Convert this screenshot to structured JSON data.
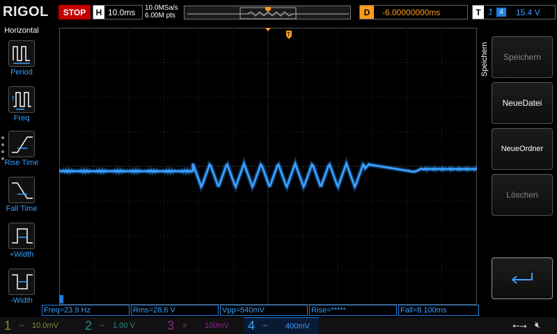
{
  "header": {
    "brand": "RIGOL",
    "run_state": "STOP",
    "horizontal": {
      "tag": "H",
      "timebase": "10.0ms"
    },
    "sample_rate": "10.0MSa/s",
    "memory_depth": "6.00M pts",
    "delay": {
      "tag": "D",
      "value": "-6.00000000ms"
    },
    "trigger": {
      "tag": "T",
      "edge_icon": "rising-edge-icon",
      "source": "4",
      "level": "15.4 V"
    }
  },
  "left_menu": {
    "title": "Horizontal",
    "items": [
      {
        "label": "Period",
        "icon": "period-icon"
      },
      {
        "label": "Freq",
        "icon": "frequency-icon"
      },
      {
        "label": "Rise Time",
        "icon": "rise-time-icon"
      },
      {
        "label": "Fall Time",
        "icon": "fall-time-icon"
      },
      {
        "label": "+Width",
        "icon": "positive-width-icon"
      },
      {
        "label": "-Width",
        "icon": "negative-width-icon"
      }
    ]
  },
  "grid": {
    "trigger_marker": "T",
    "waveform_color": "#1e7fe0"
  },
  "measurements": [
    {
      "label": "Freq=23.9 Hz"
    },
    {
      "label": "Rms=28.6 V"
    },
    {
      "label": "Vpp=540mV"
    },
    {
      "label": "Rise=*****"
    },
    {
      "label": "Fall=8.100ms"
    }
  ],
  "channels": [
    {
      "num": "1",
      "scale": "10.0mV",
      "color": "#8a8a3a"
    },
    {
      "num": "2",
      "scale": "1.00 V",
      "color": "#2a8a8a"
    },
    {
      "num": "3",
      "scale": "100mV",
      "color": "#8a2a8a"
    },
    {
      "num": "4",
      "scale": "400mV",
      "color": "#1e7fe0"
    }
  ],
  "right_menu": {
    "title": "Speichern",
    "buttons": [
      {
        "label": "Speichern",
        "state": "dim"
      },
      {
        "label": "NeueDatei",
        "state": "lit"
      },
      {
        "label": "NeueOrdner",
        "state": "lit"
      },
      {
        "label": "Löschen",
        "state": "dim"
      }
    ],
    "enter_icon": "enter-arrow-icon"
  }
}
